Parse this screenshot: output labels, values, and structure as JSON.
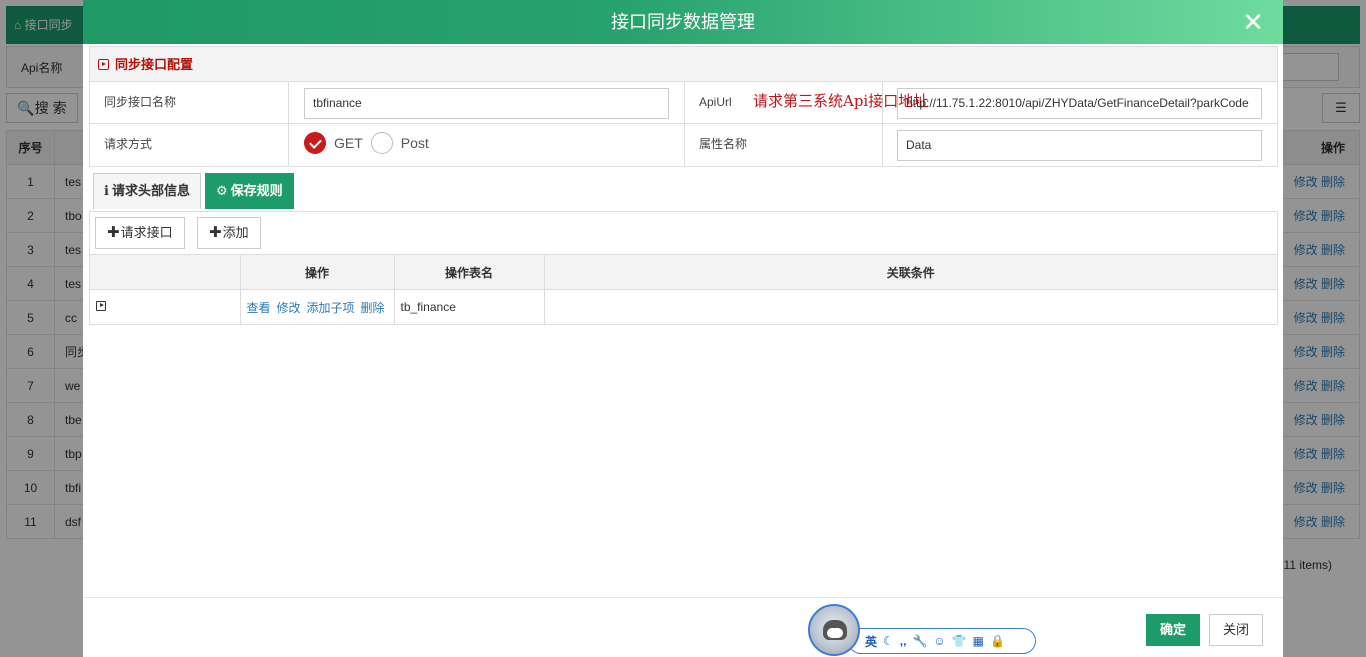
{
  "background": {
    "tab_label": "接口同步",
    "filter_label": "Api名称",
    "search_label": "搜 索",
    "columns": {
      "seq": "序号",
      "ops": "操作"
    },
    "rows": [
      {
        "n": "1",
        "name": "tes"
      },
      {
        "n": "2",
        "name": "tbo"
      },
      {
        "n": "3",
        "name": "tes"
      },
      {
        "n": "4",
        "name": "tes"
      },
      {
        "n": "5",
        "name": "cc"
      },
      {
        "n": "6",
        "name": "同步"
      },
      {
        "n": "7",
        "name": "we"
      },
      {
        "n": "8",
        "name": "tbe"
      },
      {
        "n": "9",
        "name": "tbp"
      },
      {
        "n": "10",
        "name": "tbfi"
      },
      {
        "n": "11",
        "name": "dsf"
      }
    ],
    "row_edit": "修改",
    "row_delete": "删除",
    "items_text": "11 items)"
  },
  "modal": {
    "title": "接口同步数据管理",
    "close_glyph": "✕",
    "section_title": "同步接口配置",
    "fields": {
      "name_label": "同步接口名称",
      "name_value": "tbfinance",
      "apiurl_label": "ApiUrl",
      "apiurl_hint": "请求第三系统Api接口地址",
      "apiurl_value": "http://11.75.1.22:8010/api/ZHYData/GetFinanceDetail?parkCode",
      "method_label": "请求方式",
      "method_get": "GET",
      "method_post": "Post",
      "attr_label": "属性名称",
      "attr_value": "Data"
    },
    "tabs": {
      "headers": "请求头部信息",
      "save_rules": "保存规则"
    },
    "toolbar": {
      "request_api": "请求接口",
      "add": "添加"
    },
    "grid": {
      "headers": [
        "",
        "操作",
        "操作表名",
        "关联条件"
      ],
      "row": {
        "ops": [
          "查看",
          "修改",
          "添加子项",
          "删除"
        ],
        "table_name": "tb_finance",
        "condition": ""
      }
    },
    "footer": {
      "ok": "确定",
      "close": "关闭"
    }
  },
  "ime": {
    "lang": "英",
    "icons": [
      "moon-icon",
      "punctuation-icon",
      "wrench-icon",
      "emoji-icon",
      "skin-icon",
      "grid-icon",
      "lock-icon"
    ]
  },
  "colors": {
    "primary_green": "#1e9b6b",
    "section_red": "#b2120a",
    "link_blue": "#2a7ab8"
  }
}
